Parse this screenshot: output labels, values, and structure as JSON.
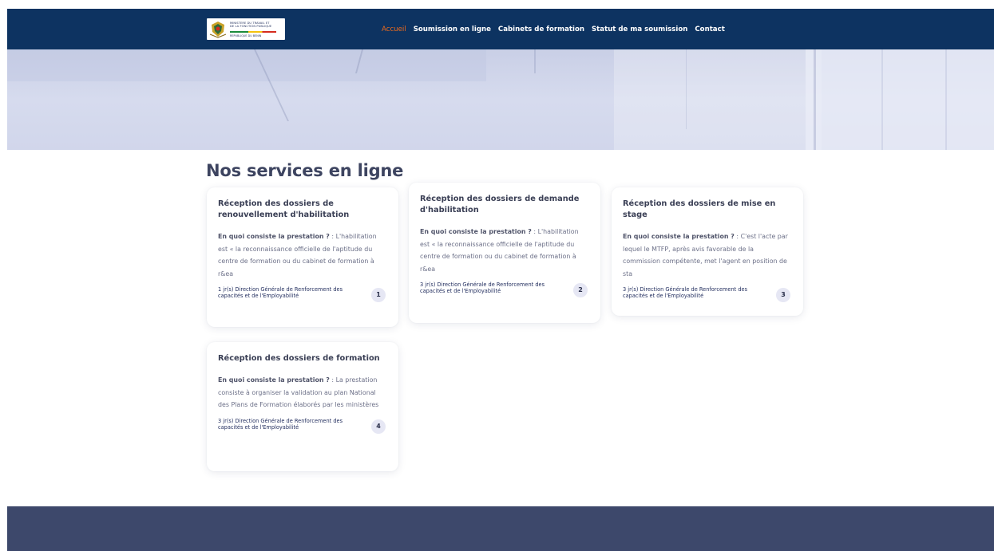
{
  "logo": {
    "line1": "MINISTERE DU TRAVAIL ET",
    "line2": "DE LA FONCTION PUBLIQUE",
    "line3": "REPUBLIQUE DU BENIN"
  },
  "nav": {
    "items": [
      "Accueil",
      "Soumission en ligne",
      "Cabinets de formation",
      "Statut de ma soumission",
      "Contact"
    ],
    "active_color": "#f26c1b",
    "background": "#0d3361"
  },
  "section": {
    "title": "Nos services en ligne"
  },
  "cards": [
    {
      "title": "Réception des dossiers de renouvellement d'habilitation",
      "lead": "En quoi consiste la prestation ?",
      "text": " : L'habilitation est « la reconnaissance officielle de l'aptitude du centre de formation ou du cabinet de formation à r&ea",
      "duration": "1 jr(s)",
      "org": " Direction Générale de Renforcement des capacités et de l'Employabilité",
      "number": "1"
    },
    {
      "title": "Réception des dossiers de demande d'habilitation",
      "lead": "En quoi consiste la prestation ?",
      "text": " : L'habilitation est « la reconnaissance officielle de l'aptitude du centre de formation ou du cabinet de formation à r&ea",
      "duration": "3 jr(s)",
      "org": " Direction Générale de Renforcement des capacités et de l'Employabilité",
      "number": "2"
    },
    {
      "title": "Réception des dossiers de mise en stage",
      "lead": "En quoi consiste la prestation ?",
      "text": " : C'est l'acte par lequel le MTFP, après avis favorable de la commission compétente, met l'agent en position de sta",
      "duration": "3 jr(s)",
      "org": " Direction Générale de Renforcement des capacités et de l'Employabilité",
      "number": "3"
    },
    {
      "title": "Réception des dossiers de formation",
      "lead": "En quoi consiste la prestation ?",
      "text": " : La prestation consiste à organiser la validation au plan National des Plans de Formation élaborés par les ministères",
      "duration": "3 jr(s)",
      "org": " Direction Générale de Renforcement des capacités et de l'Employabilité",
      "number": "4"
    }
  ],
  "footer": {
    "background": "#3d486b"
  }
}
